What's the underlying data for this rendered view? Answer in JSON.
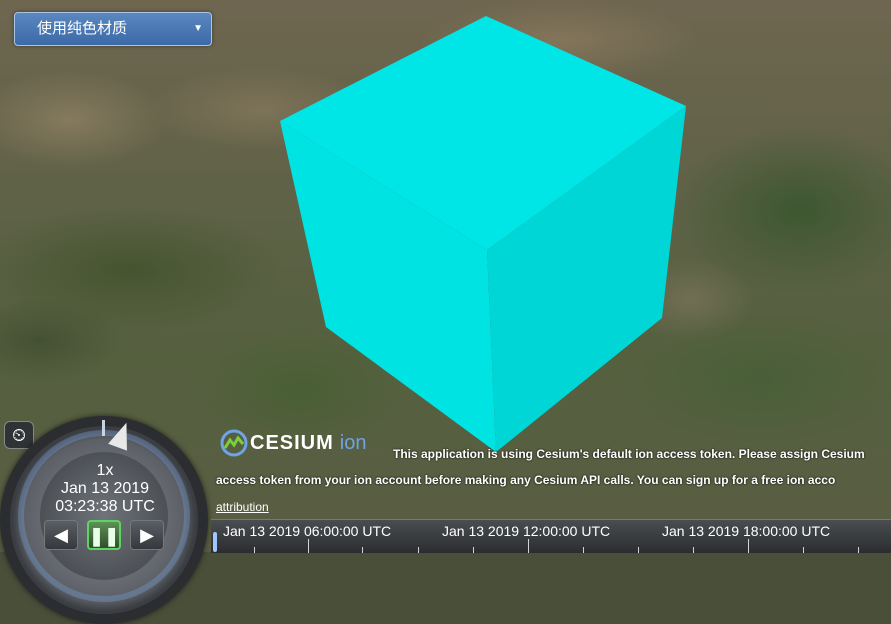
{
  "toolbar": {
    "material_select": "使用纯色材质"
  },
  "box": {
    "color": "#00e5e5"
  },
  "animation": {
    "speed": "1x",
    "date": "Jan 13 2019",
    "time": "03:23:38 UTC"
  },
  "credits": {
    "logo_cesium": "CESIUM",
    "logo_ion": "ion",
    "line1": "This application is using Cesium's default ion access token. Please assign Cesium",
    "line2": "access token from your ion account before making any Cesium API calls. You can sign up for a free ion acco",
    "attribution": "attribution"
  },
  "timeline": {
    "labels": [
      "Jan 13 2019 06:00:00 UTC",
      "Jan 13 2019 12:00:00 UTC",
      "Jan 13 2019 18:00:00 UTC"
    ]
  }
}
